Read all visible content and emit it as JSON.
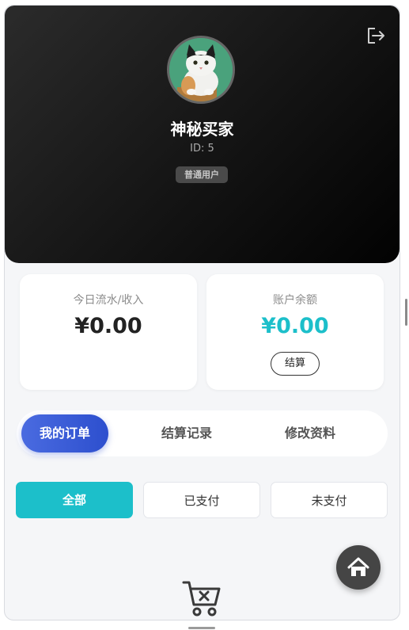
{
  "profile": {
    "name": "神秘买家",
    "id_text": "ID: 5",
    "role_badge": "普通用户",
    "avatar_icon": "cat-avatar"
  },
  "stats": {
    "today": {
      "label": "今日流水/收入",
      "value": "¥0.00"
    },
    "balance": {
      "label": "账户余额",
      "value": "¥0.00",
      "button": "结算"
    }
  },
  "tabs": [
    {
      "label": "我的订单",
      "active": true
    },
    {
      "label": "结算记录",
      "active": false
    },
    {
      "label": "修改资料",
      "active": false
    }
  ],
  "filters": [
    {
      "label": "全部",
      "active": true
    },
    {
      "label": "已支付",
      "active": false
    },
    {
      "label": "未支付",
      "active": false
    }
  ],
  "icons": {
    "logout": "logout-icon",
    "home": "home-icon",
    "empty_orders": "empty-cart-icon"
  },
  "colors": {
    "accent": "#1cbfca",
    "tab_active": "#2d4fce",
    "header_dark": "#141414"
  }
}
